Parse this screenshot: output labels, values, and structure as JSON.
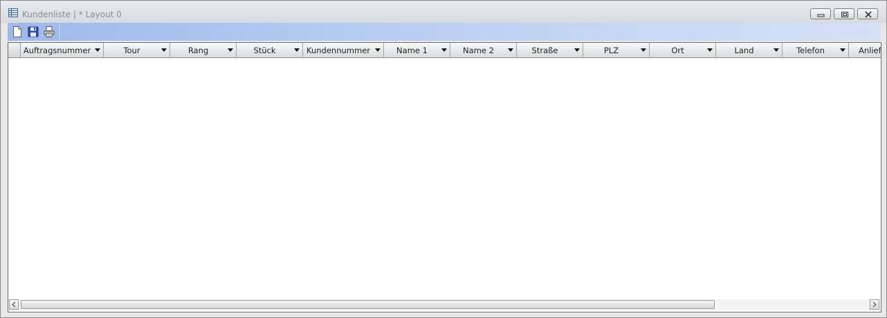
{
  "window": {
    "title": "Kundenliste | * Layout 0",
    "icon": "table-list-icon"
  },
  "titlebar_buttons": [
    {
      "name": "minimize",
      "icon": "minimize-icon"
    },
    {
      "name": "restore",
      "icon": "restore-icon"
    },
    {
      "name": "close",
      "icon": "close-icon"
    }
  ],
  "toolbar": {
    "items": [
      {
        "name": "new",
        "icon": "new-document-icon"
      },
      {
        "name": "save",
        "icon": "save-disk-icon"
      },
      {
        "name": "print",
        "icon": "printer-icon"
      }
    ]
  },
  "grid": {
    "columns": [
      {
        "label": "Auftragsnummer"
      },
      {
        "label": "Tour"
      },
      {
        "label": "Rang"
      },
      {
        "label": "Stück"
      },
      {
        "label": "Kundennummer"
      },
      {
        "label": "Name 1"
      },
      {
        "label": "Name 2"
      },
      {
        "label": "Straße"
      },
      {
        "label": "PLZ"
      },
      {
        "label": "Ort"
      },
      {
        "label": "Land"
      },
      {
        "label": "Telefon"
      },
      {
        "label": "Anliefe"
      }
    ],
    "rows": []
  },
  "colors": {
    "toolbar_start": "#9fb9ec",
    "toolbar_end": "#d5e1f7",
    "title_text": "#8b8b8b",
    "grid_background": "#ffffff"
  }
}
